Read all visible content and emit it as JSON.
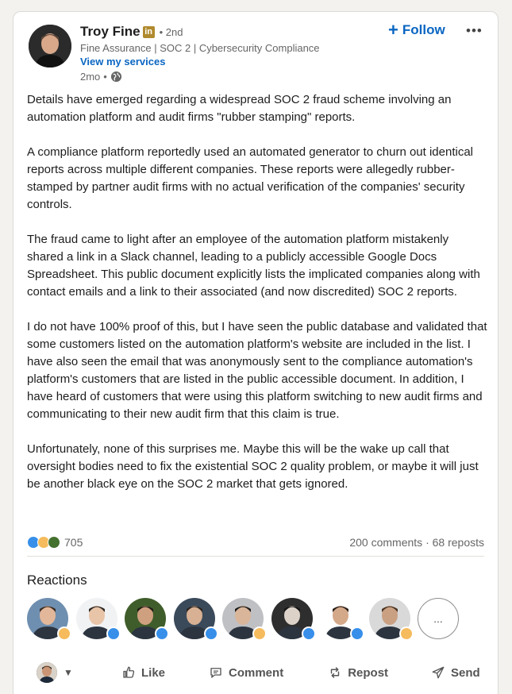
{
  "author": {
    "name": "Troy Fine",
    "linkedin_badge": "in",
    "degree": "• 2nd",
    "headline": "Fine Assurance | SOC 2 | Cybersecurity Compliance",
    "services_link": "View my services",
    "time": "2mo",
    "meta_separator": "•",
    "visibility_icon": "globe-icon"
  },
  "follow_label": "Follow",
  "more_menu": "•••",
  "post_paragraphs": [
    "Details have emerged regarding a widespread SOC 2 fraud scheme involving an automation platform and audit firms \"rubber stamping\" reports.",
    "A compliance platform reportedly used an automated generator to churn out identical reports across multiple different companies. These reports were allegedly rubber-stamped by partner audit firms with no actual verification of the companies' security controls.",
    "The fraud came to light after an employee of the automation platform mistakenly shared a link in a Slack channel, leading to a publicly accessible Google Docs Spreadsheet. This public document explicitly lists the implicated companies along with contact emails and a link to their associated (and now discredited) SOC 2 reports.",
    "I do not have 100% proof of this, but I have seen the public database and validated that some customers listed on the automation platform's website are included in the list. I have also seen the email that was anonymously sent to the compliance automation's platform's customers that are listed in the public accessible document. In addition, I have heard of customers that were using this platform switching to new audit firms and communicating to their new audit firm that this claim is true.",
    "Unfortunately, none of this surprises me. Maybe this will be the wake up call that oversight bodies need to fix the existential SOC 2 quality problem, or maybe it will just be another black eye on the SOC 2 market that gets ignored."
  ],
  "social": {
    "reaction_types": [
      "like-reaction-icon",
      "insightful-reaction-icon",
      "support-reaction-icon"
    ],
    "reaction_count": "705",
    "comments_reposts": "200 comments · 68 reposts"
  },
  "reactions_title": "Reactions",
  "reactors": [
    {
      "bg": "#6f8fb0",
      "skin": "#e3b89a",
      "hair": "#3a2c22",
      "reaction": "insight"
    },
    {
      "bg": "#f1f2f4",
      "skin": "#e8c4a8",
      "hair": "#2f2a26",
      "reaction": "like"
    },
    {
      "bg": "#3f5d2a",
      "skin": "#cfa07f",
      "hair": "#1f1a16",
      "reaction": "like"
    },
    {
      "bg": "#3b4a5a",
      "skin": "#d8b093",
      "hair": "#2a2420",
      "reaction": "like"
    },
    {
      "bg": "#bfc0c3",
      "skin": "#d9b59a",
      "hair": "#1d1b1a",
      "reaction": "insight"
    },
    {
      "bg": "#2e2e2e",
      "skin": "#dcd2c8",
      "hair": "#141414",
      "reaction": "like"
    },
    {
      "bg": "#ffffff",
      "skin": "#d4a98a",
      "hair": "#2a1f19",
      "reaction": "like"
    },
    {
      "bg": "#d9d9d9",
      "skin": "#caa083",
      "hair": "#4a3524",
      "reaction": "insight"
    }
  ],
  "more_reactors_label": "...",
  "actions": {
    "like": "Like",
    "comment": "Comment",
    "repost": "Repost",
    "send": "Send"
  }
}
